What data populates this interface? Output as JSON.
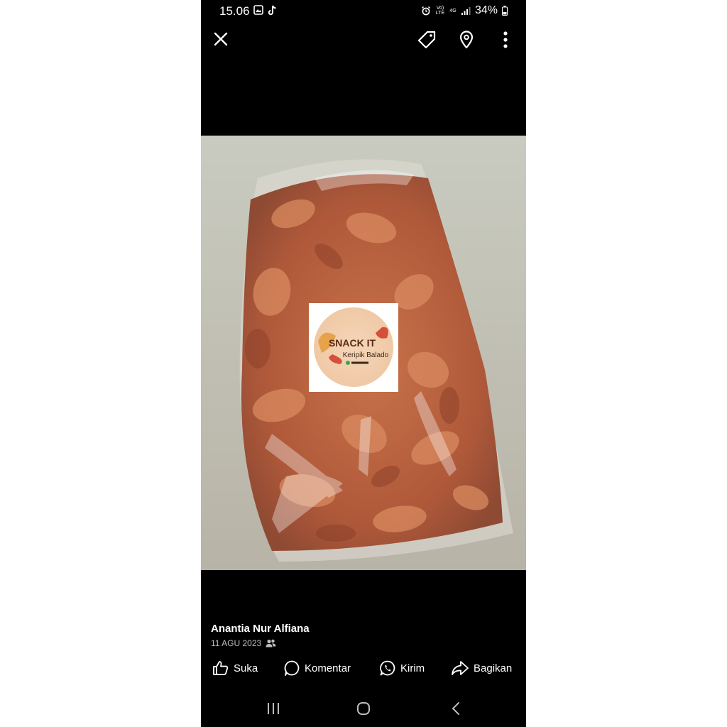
{
  "status_bar": {
    "time": "15.06",
    "network_volte": "Vo) LTE",
    "network_4g": "4G",
    "battery": "34%"
  },
  "toolbar": {
    "close_icon": "close-icon",
    "tag_icon": "tag-icon",
    "location_icon": "location-pin-icon",
    "more_icon": "more-vertical-icon"
  },
  "photo": {
    "label_brand": "SNACK IT",
    "label_product": "Keripik Balado"
  },
  "post": {
    "author": "Anantia Nur Alfiana",
    "date": "11 AGU 2023",
    "audience_icon": "friends-icon"
  },
  "actions": {
    "like": "Suka",
    "comment": "Komentar",
    "send": "Kirim",
    "share": "Bagikan"
  },
  "colors": {
    "background": "#000000",
    "page": "#ffffff",
    "secondary_text": "#bdbdbd"
  }
}
